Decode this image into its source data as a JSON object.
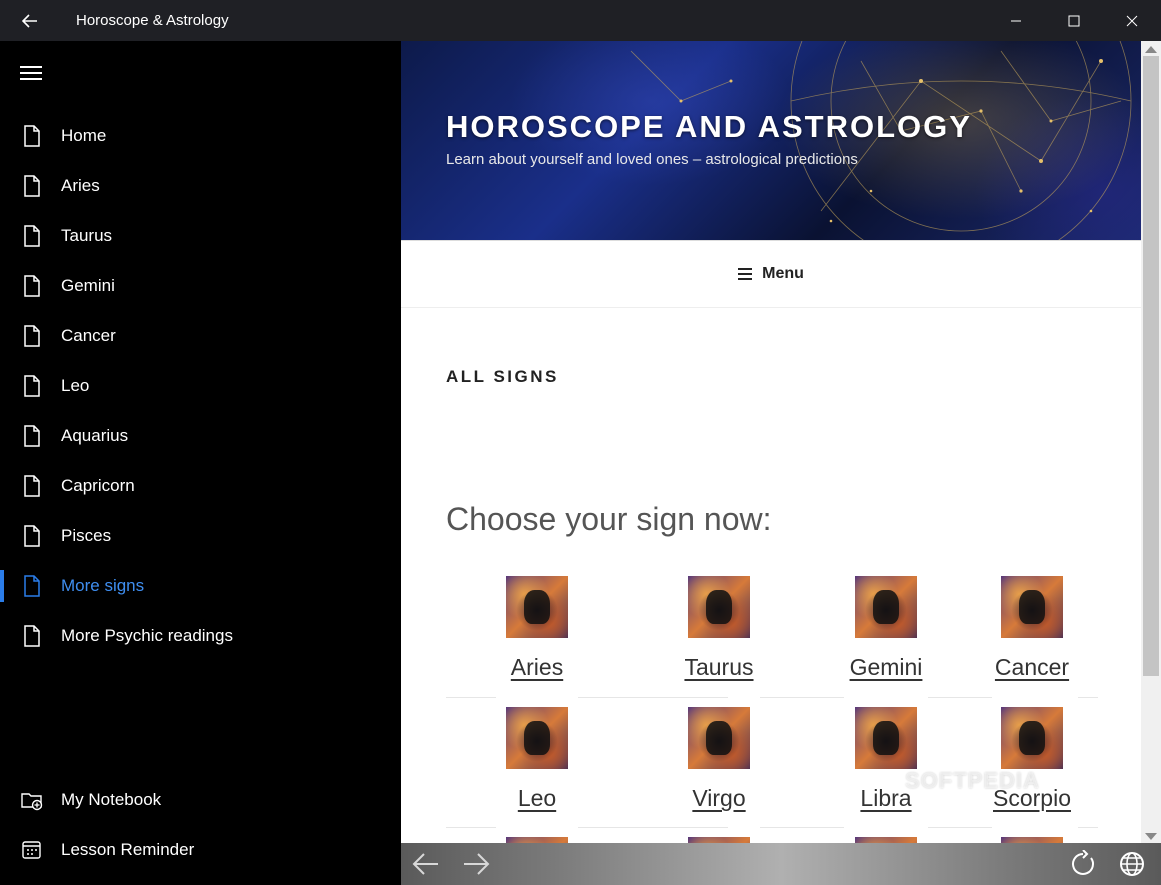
{
  "window": {
    "title": "Horoscope & Astrology"
  },
  "sidebar": {
    "items": [
      {
        "label": "Home",
        "active": false
      },
      {
        "label": "Aries",
        "active": false
      },
      {
        "label": "Taurus",
        "active": false
      },
      {
        "label": "Gemini",
        "active": false
      },
      {
        "label": "Cancer",
        "active": false
      },
      {
        "label": "Leo",
        "active": false
      },
      {
        "label": "Aquarius",
        "active": false
      },
      {
        "label": "Capricorn",
        "active": false
      },
      {
        "label": "Pisces",
        "active": false
      },
      {
        "label": "More signs",
        "active": true
      },
      {
        "label": "More Psychic readings",
        "active": false
      }
    ],
    "footer": [
      {
        "label": "My Notebook",
        "icon": "folder-add-icon"
      },
      {
        "label": "Lesson Reminder",
        "icon": "calendar-icon"
      }
    ],
    "accent_color": "#2b7de9"
  },
  "site": {
    "title": "HOROSCOPE AND ASTROLOGY",
    "tagline": "Learn about yourself and loved ones – astrological predictions",
    "menu_label": "Menu"
  },
  "page": {
    "section_title": "ALL SIGNS",
    "heading": "Choose your sign now:",
    "signs_row1": [
      "Aries",
      "Taurus",
      "Gemini",
      "Cancer"
    ],
    "signs_row2": [
      "Leo",
      "Virgo",
      "Libra",
      "Scorpio"
    ]
  },
  "watermark": "SOFTPEDIA"
}
